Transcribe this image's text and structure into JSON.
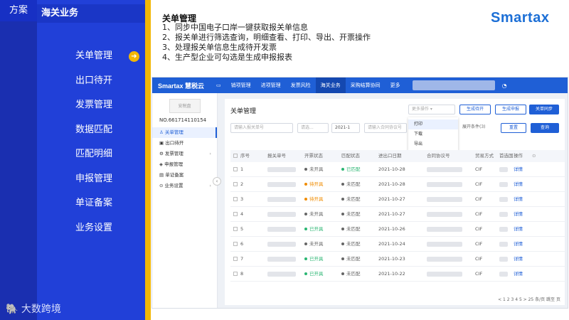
{
  "slide": {
    "solution_tag": "方案",
    "business_tag": "海关业务",
    "menu": [
      "关单管理",
      "出口待开",
      "发票管理",
      "数据匹配",
      "匹配明细",
      "申报管理",
      "单证备案",
      "业务设置"
    ],
    "active_arrow": "➜",
    "footer_logo": "大数跨境",
    "title": "关单管理",
    "points": [
      "1、同步中国电子口岸一键获取报关单信息",
      "2、报关单进行筛选查询，明细查看、打印、导出、开票操作",
      "3、处理报关单信息生成待开发票",
      "4、生产型企业可勾选是生成申报报表"
    ],
    "brand": "Smartax"
  },
  "app": {
    "brand": "Smartax 慧税云",
    "nav": [
      "销项管理",
      "进项管理",
      "发票风险",
      "海关业务",
      "采购结算协同",
      "更多"
    ],
    "company_no": "NO.661714110154",
    "stamp": "安税盘",
    "side": [
      {
        "label": "关单管理",
        "icon": "person",
        "active": true
      },
      {
        "label": "出口待开",
        "icon": "box"
      },
      {
        "label": "发票管理",
        "icon": "gear",
        "chev": true
      },
      {
        "label": "申报管理",
        "icon": "layers"
      },
      {
        "label": "单证备案",
        "icon": "doc"
      },
      {
        "label": "业务设置",
        "icon": "gear",
        "chev": true
      }
    ],
    "page_title": "关单管理",
    "more_ops": "更多操作",
    "btn_generate": "生成待开",
    "btn_declare": "生成申报",
    "btn_sync": "关单同步",
    "dropdown": [
      "打印",
      "下载",
      "导出"
    ],
    "filter_placeholder": "请输入报关单号",
    "filter_date1": "请选...",
    "filter_date2": "2021-1",
    "filter_contract": "请输入合同协议号",
    "filter_more": "展开条件(3)",
    "btn_reset": "重置",
    "btn_query": "查询",
    "columns": [
      "序号",
      "报关单号",
      "开票状态",
      "匹配状态",
      "进出口日期",
      "合同协议号",
      "贸易方式",
      "首选国",
      "操作"
    ],
    "rows": [
      {
        "no": "1",
        "invoice": "未开具",
        "invoice_color": "#666666",
        "match": "已匹配",
        "match_color": "#2bb673",
        "date": "2021-10-28",
        "trade": "CIF",
        "op": "详情"
      },
      {
        "no": "2",
        "invoice": "待开具",
        "invoice_color": "#f08c00",
        "match": "未匹配",
        "match_color": "#666666",
        "date": "2021-10-28",
        "trade": "CIF",
        "op": "详情"
      },
      {
        "no": "3",
        "invoice": "待开具",
        "invoice_color": "#f08c00",
        "match": "未匹配",
        "match_color": "#666666",
        "date": "2021-10-27",
        "trade": "CIF",
        "op": "详情"
      },
      {
        "no": "4",
        "invoice": "未开具",
        "invoice_color": "#666666",
        "match": "未匹配",
        "match_color": "#666666",
        "date": "2021-10-27",
        "trade": "CIF",
        "op": "详情"
      },
      {
        "no": "5",
        "invoice": "已开具",
        "invoice_color": "#2bb673",
        "match": "未匹配",
        "match_color": "#666666",
        "date": "2021-10-26",
        "trade": "CIF",
        "op": "详情"
      },
      {
        "no": "6",
        "invoice": "未开具",
        "invoice_color": "#666666",
        "match": "未匹配",
        "match_color": "#666666",
        "date": "2021-10-24",
        "trade": "CIF",
        "op": "详情"
      },
      {
        "no": "7",
        "invoice": "已开具",
        "invoice_color": "#2bb673",
        "match": "未匹配",
        "match_color": "#666666",
        "date": "2021-10-23",
        "trade": "CIF",
        "op": "详情"
      },
      {
        "no": "8",
        "invoice": "已开具",
        "invoice_color": "#2bb673",
        "match": "未匹配",
        "match_color": "#666666",
        "date": "2021-10-22",
        "trade": "CIF",
        "op": "详情"
      }
    ],
    "pager": "< 1 2 3 4 5 >  25 条/页  跳至    页"
  }
}
